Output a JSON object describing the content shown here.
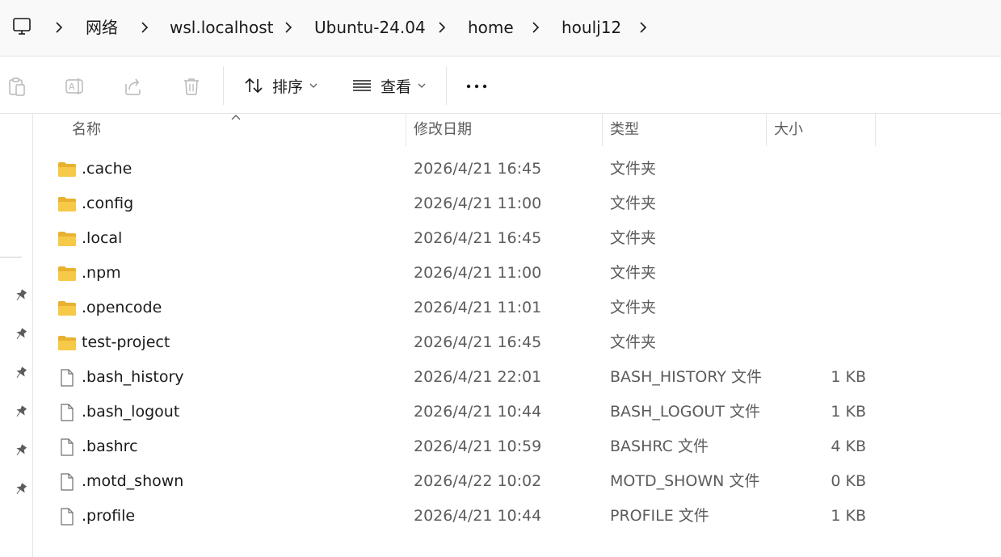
{
  "breadcrumb": {
    "root_icon": "computer-icon",
    "items": [
      "网络",
      "wsl.localhost",
      "Ubuntu-24.04",
      "home",
      "houlj12"
    ]
  },
  "toolbar": {
    "icons": [
      "paste-icon",
      "rename-icon",
      "share-icon",
      "delete-icon"
    ],
    "sort_label": "排序",
    "view_label": "查看",
    "more_icon": "more-icon"
  },
  "columns": {
    "name": "名称",
    "date": "修改日期",
    "type": "类型",
    "size": "大小"
  },
  "files": [
    {
      "name": ".cache",
      "date": "2026/4/21 16:45",
      "type": "文件夹",
      "size": "",
      "icon": "folder-icon"
    },
    {
      "name": ".config",
      "date": "2026/4/21 11:00",
      "type": "文件夹",
      "size": "",
      "icon": "folder-icon"
    },
    {
      "name": ".local",
      "date": "2026/4/21 16:45",
      "type": "文件夹",
      "size": "",
      "icon": "folder-icon"
    },
    {
      "name": ".npm",
      "date": "2026/4/21 11:00",
      "type": "文件夹",
      "size": "",
      "icon": "folder-icon"
    },
    {
      "name": ".opencode",
      "date": "2026/4/21 11:01",
      "type": "文件夹",
      "size": "",
      "icon": "folder-icon"
    },
    {
      "name": "test-project",
      "date": "2026/4/21 16:45",
      "type": "文件夹",
      "size": "",
      "icon": "folder-icon"
    },
    {
      "name": ".bash_history",
      "date": "2026/4/21 22:01",
      "type": "BASH_HISTORY 文件",
      "size": "1 KB",
      "icon": "file-icon"
    },
    {
      "name": ".bash_logout",
      "date": "2026/4/21 10:44",
      "type": "BASH_LOGOUT 文件",
      "size": "1 KB",
      "icon": "file-icon"
    },
    {
      "name": ".bashrc",
      "date": "2026/4/21 10:59",
      "type": "BASHRC 文件",
      "size": "4 KB",
      "icon": "file-icon"
    },
    {
      "name": ".motd_shown",
      "date": "2026/4/22 10:02",
      "type": "MOTD_SHOWN 文件",
      "size": "0 KB",
      "icon": "file-icon"
    },
    {
      "name": ".profile",
      "date": "2026/4/21 10:44",
      "type": "PROFILE 文件",
      "size": "1 KB",
      "icon": "file-icon"
    }
  ],
  "colors": {
    "folder": "#f7c948",
    "folder_dark": "#e8b12f",
    "accent": "#0067c0",
    "text_secondary": "#5c5c5c"
  }
}
